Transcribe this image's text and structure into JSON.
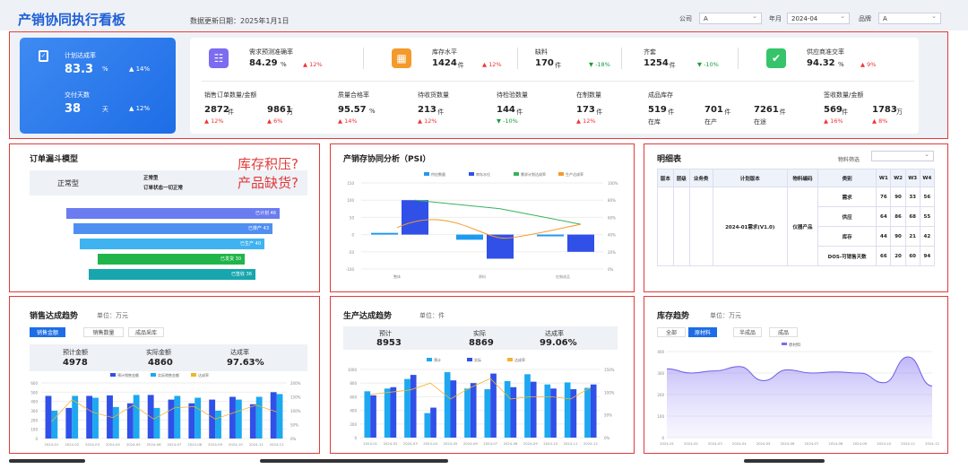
{
  "header": {
    "title": "产销协同执行看板",
    "update": "数据更新日期：2025年1月1日",
    "filters": [
      {
        "label": "公司",
        "value": "A"
      },
      {
        "label": "年月",
        "value": "2024-04"
      },
      {
        "label": "品牌",
        "value": "A"
      }
    ]
  },
  "blue_card": {
    "k1_label": "计划达成率",
    "k1_value": "83.3",
    "k1_unit": "%",
    "k1_change": "▲ 14%",
    "k2_label": "交付天数",
    "k2_value": "38",
    "k2_unit": "天",
    "k2_change": "▲ 12%"
  },
  "top_kpis": [
    {
      "label": "需求预测准确率",
      "value": "84.29",
      "unit": "%",
      "change": "▲ 12%",
      "dir": "up",
      "icon": "forecast-icon",
      "color": "#7b6cf0"
    },
    {
      "label": "库存水平",
      "value": "1424",
      "unit": "件",
      "change": "▲ 12%",
      "dir": "up",
      "icon": "warehouse-icon",
      "color": "#f39a2b"
    },
    {
      "label": "缺料",
      "value": "170",
      "unit": "件",
      "change": "▼ -18%",
      "dir": "dn",
      "icon": "",
      "color": ""
    },
    {
      "label": "齐套",
      "value": "1254",
      "unit": "件",
      "change": "▼ -10%",
      "dir": "dn",
      "icon": "",
      "color": ""
    },
    {
      "label": "供应商准交率",
      "value": "94.32",
      "unit": "%",
      "change": "▲ 9%",
      "dir": "up",
      "icon": "delivery-icon",
      "color": "#36c46a"
    }
  ],
  "row2": {
    "order": {
      "label": "销售订单数量/金额",
      "v1": "2872",
      "u1": "件",
      "c1": "▲ 12%",
      "v2": "9861",
      "u2": "万",
      "c2": "▲ 6%"
    },
    "quality": {
      "label": "质量合格率",
      "value": "95.57",
      "unit": "%",
      "change": "▲ 14%"
    },
    "receive": {
      "label": "待收货数量",
      "value": "213",
      "unit": "件",
      "change": "▲ 12%"
    },
    "inspect": {
      "label": "待检验数量",
      "value": "144",
      "unit": "件",
      "change": "▼ -10%"
    },
    "wip": {
      "label": "在制数量",
      "value": "173",
      "unit": "件",
      "change": "▲ 12%"
    },
    "fg": {
      "label": "成品库存",
      "items": [
        {
          "v": "519",
          "u": "件",
          "s": "在库"
        },
        {
          "v": "701",
          "u": "件",
          "s": "在产"
        },
        {
          "v": "7261",
          "u": "件",
          "s": "在途"
        }
      ]
    },
    "sign": {
      "label": "签收数量/金额",
      "v1": "569",
      "u1": "件",
      "c1": "▲ 16%",
      "v2": "1783",
      "u2": "万",
      "c2": "▲ 8%"
    }
  },
  "funnel": {
    "title": "订单漏斗模型",
    "type": "正常型",
    "desc1": "正常型",
    "desc2": "订单状态一切正常",
    "bars": [
      {
        "label": "已计划",
        "value": 46,
        "color": "#6a7cf0"
      },
      {
        "label": "已排产",
        "value": 43,
        "color": "#4f8ff2"
      },
      {
        "label": "已生产",
        "value": 40,
        "color": "#3fb3ef"
      },
      {
        "label": "已发货",
        "value": 30,
        "color": "#1fb54a"
      },
      {
        "label": "已签收",
        "value": 36,
        "color": "#17a6ad"
      }
    ]
  },
  "annotation": {
    "line1": "库存积压?",
    "line2": "产品缺货?"
  },
  "psi": {
    "title": "产销存协同分析（PSI）",
    "legend": [
      "供应数量",
      "库存水位",
      "需求计划达成率",
      "生产达成率"
    ]
  },
  "detail": {
    "title": "明细表",
    "filter_label": "物料筛选",
    "headers": [
      "版本",
      "层级",
      "业务类",
      "计划版本",
      "物料编码",
      "类别",
      "W1",
      "W2",
      "W3",
      "W4"
    ],
    "plan": "2024-01需求(V1.0)",
    "material": "仪器产品",
    "rows": [
      {
        "cat": "需求",
        "w": [
          76,
          90,
          33,
          56
        ]
      },
      {
        "cat": "供应",
        "w": [
          64,
          86,
          68,
          55
        ]
      },
      {
        "cat": "库存",
        "w": [
          44,
          90,
          21,
          42
        ]
      },
      {
        "cat": "DOS-可销售天数",
        "w": [
          66,
          20,
          60,
          94
        ]
      }
    ]
  },
  "sales": {
    "title": "销售达成趋势",
    "unit": "单位：万元",
    "tabs": [
      "销售金额",
      "销售数量",
      "成品采库"
    ],
    "s1l": "预计金额",
    "s1v": "4978",
    "s2l": "实际金额",
    "s2v": "4860",
    "s3l": "达成率",
    "s3v": "97.63%",
    "legend": [
      "预计销售金额",
      "实际销售金额",
      "达成率"
    ]
  },
  "prod": {
    "title": "生产达成趋势",
    "unit": "单位：件",
    "s1l": "预计",
    "s1v": "8953",
    "s2l": "实际",
    "s2v": "8869",
    "s3l": "达成率",
    "s3v": "99.06%",
    "legend": [
      "预计",
      "实际",
      "达成率"
    ]
  },
  "inv": {
    "title": "库存趋势",
    "unit": "单位：万元",
    "tabs": [
      "全部",
      "原材料",
      "半成品",
      "成品"
    ],
    "legend": "原材料"
  },
  "chart_data": [
    {
      "type": "bar",
      "title": "产销存协同分析（PSI）",
      "categories": [
        "整体",
        "原料",
        "在制成品"
      ],
      "series": [
        {
          "name": "供应数量",
          "values": [
            5,
            -15,
            -5
          ]
        },
        {
          "name": "库存水位",
          "values": [
            100,
            -70,
            -50
          ]
        },
        {
          "name": "需求计划达成率",
          "values": [
            80,
            70,
            52
          ]
        },
        {
          "name": "生产达成率",
          "values": [
            62,
            30,
            30
          ]
        }
      ],
      "ylim": [
        -100,
        150
      ],
      "y2lim": [
        0,
        100
      ]
    },
    {
      "type": "bar",
      "title": "销售达成趋势",
      "categories": [
        "2024-01",
        "2024-02",
        "2024-03",
        "2024-04",
        "2024-05",
        "2024-06",
        "2024-07",
        "2024-08",
        "2024-09",
        "2024-10",
        "2024-11",
        "2024-12"
      ],
      "series": [
        {
          "name": "预计销售金额",
          "values": [
            460,
            330,
            460,
            465,
            380,
            470,
            420,
            380,
            420,
            450,
            370,
            500
          ]
        },
        {
          "name": "实际销售金额",
          "values": [
            300,
            460,
            440,
            340,
            470,
            330,
            460,
            440,
            300,
            420,
            450,
            480
          ]
        },
        {
          "name": "达成率",
          "values": [
            60,
            140,
            95,
            75,
            120,
            70,
            110,
            115,
            70,
            95,
            120,
            96
          ]
        }
      ],
      "ylim": [
        0,
        600
      ],
      "y2lim": [
        0,
        200
      ]
    },
    {
      "type": "bar",
      "title": "生产达成趋势",
      "categories": [
        "2024-01",
        "2024-02",
        "2024-03",
        "2024-04",
        "2024-05",
        "2024-06",
        "2024-07",
        "2024-08",
        "2024-09",
        "2024-10",
        "2024-11",
        "2024-12"
      ],
      "series": [
        {
          "name": "预计",
          "values": [
            680,
            720,
            860,
            360,
            960,
            720,
            710,
            830,
            930,
            780,
            810,
            730
          ]
        },
        {
          "name": "实际",
          "values": [
            620,
            740,
            920,
            440,
            840,
            800,
            940,
            740,
            820,
            720,
            710,
            780
          ]
        },
        {
          "name": "达成率",
          "values": [
            95,
            100,
            105,
            120,
            85,
            110,
            130,
            85,
            90,
            90,
            85,
            110
          ]
        }
      ],
      "ylim": [
        0,
        1000
      ],
      "y2lim": [
        0,
        150
      ]
    },
    {
      "type": "area",
      "title": "库存趋势",
      "categories": [
        "2024-01",
        "2024-02",
        "2024-03",
        "2024-04",
        "2024-05",
        "2024-06",
        "2024-07",
        "2024-08",
        "2024-09",
        "2024-10",
        "2024-11",
        "2024-12"
      ],
      "series": [
        {
          "name": "原材料",
          "values": [
            320,
            300,
            310,
            330,
            265,
            315,
            300,
            305,
            300,
            255,
            375,
            240
          ]
        }
      ],
      "ylim": [
        0,
        400
      ]
    }
  ]
}
